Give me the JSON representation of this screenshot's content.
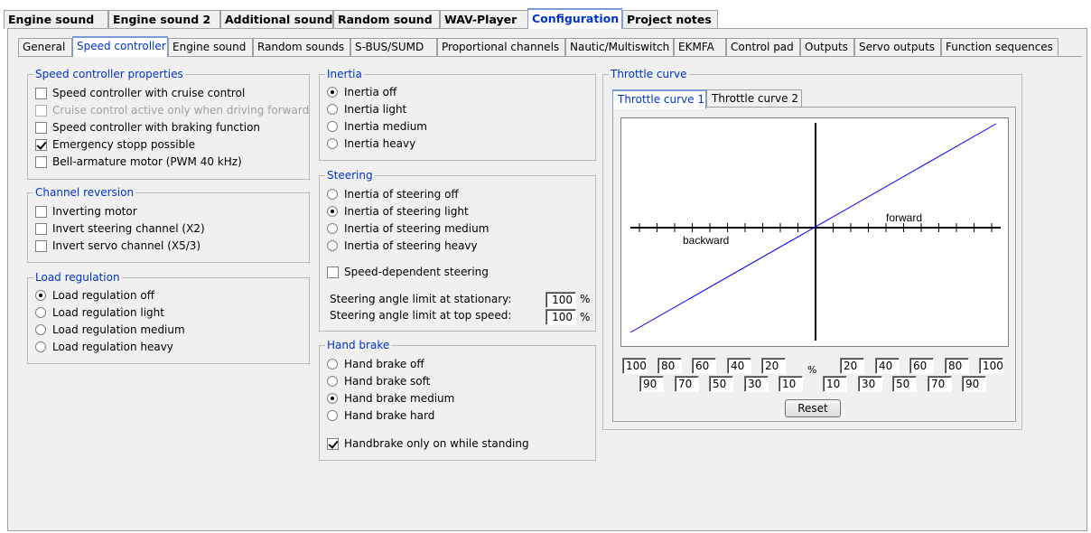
{
  "top_tabs": [
    "Engine sound",
    "Engine sound 2",
    "Additional sound",
    "Random sound",
    "WAV-Player",
    "Configuration",
    "Project notes"
  ],
  "sub_tabs": [
    "General",
    "Speed controller",
    "Engine sound",
    "Random sounds",
    "S-BUS/SUMD",
    "Proportional channels",
    "Nautic/Multiswitch",
    "EKMFA",
    "Control pad",
    "Outputs",
    "Servo outputs",
    "Function sequences"
  ],
  "speed_controller_properties": {
    "title": "Speed controller properties",
    "items": [
      {
        "label": "Speed controller with cruise control",
        "checked": false,
        "disabled": false
      },
      {
        "label": "Cruise control active only when driving forward",
        "checked": false,
        "disabled": true
      },
      {
        "label": "Speed controller with braking function",
        "checked": false,
        "disabled": false
      },
      {
        "label": "Emergency stopp possible",
        "checked": true,
        "disabled": false
      },
      {
        "label": "Bell-armature motor (PWM 40 kHz)",
        "checked": false,
        "disabled": false
      }
    ]
  },
  "channel_reversion": {
    "title": "Channel reversion",
    "items": [
      {
        "label": "Inverting motor",
        "checked": false
      },
      {
        "label": "Invert steering channel (X2)",
        "checked": false
      },
      {
        "label": "Invert servo channel (X5/3)",
        "checked": false
      }
    ]
  },
  "load_regulation": {
    "title": "Load regulation",
    "items": [
      {
        "label": "Load regulation off",
        "checked": true
      },
      {
        "label": "Load regulation light",
        "checked": false
      },
      {
        "label": "Load regulation medium",
        "checked": false
      },
      {
        "label": "Load regulation heavy",
        "checked": false
      }
    ]
  },
  "inertia": {
    "title": "Inertia",
    "items": [
      {
        "label": "Inertia off",
        "checked": true
      },
      {
        "label": "Inertia light",
        "checked": false
      },
      {
        "label": "Inertia medium",
        "checked": false
      },
      {
        "label": "Inertia heavy",
        "checked": false
      }
    ]
  },
  "steering": {
    "title": "Steering",
    "items": [
      {
        "label": "Inertia of steering off",
        "checked": false
      },
      {
        "label": "Inertia of steering light",
        "checked": true
      },
      {
        "label": "Inertia of steering medium",
        "checked": false
      },
      {
        "label": "Inertia of steering heavy",
        "checked": false
      }
    ],
    "speed_dependent_label": "Speed-dependent steering",
    "speed_dependent_checked": false,
    "limit_stationary_label": "Steering angle limit at stationary:",
    "limit_stationary_value": "100",
    "limit_top_label": "Steering angle limit at top speed:",
    "limit_top_value": "100",
    "percent": "%"
  },
  "hand_brake": {
    "title": "Hand brake",
    "items": [
      {
        "label": "Hand brake off",
        "checked": false
      },
      {
        "label": "Hand brake soft",
        "checked": false
      },
      {
        "label": "Hand brake medium",
        "checked": true
      },
      {
        "label": "Hand brake hard",
        "checked": false
      }
    ],
    "only_standing_label": "Handbrake only on while standing",
    "only_standing_checked": true
  },
  "throttle_curve": {
    "title": "Throttle curve",
    "tabs": [
      "Throttle curve 1",
      "Throttle curve 2"
    ],
    "forward_label": "forward",
    "backward_label": "backward",
    "row1_left": [
      "100",
      "80",
      "60",
      "40",
      "20"
    ],
    "row1_right": [
      "20",
      "40",
      "60",
      "80",
      "100"
    ],
    "row2_left": [
      "90",
      "70",
      "50",
      "30",
      "10"
    ],
    "row2_right": [
      "10",
      "30",
      "50",
      "70",
      "90"
    ],
    "percent": "%",
    "reset_label": "Reset",
    "line_color": "#0000ff"
  }
}
